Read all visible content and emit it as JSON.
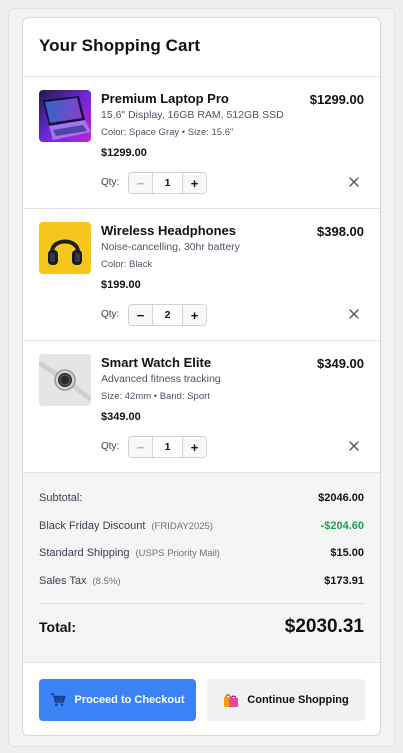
{
  "cart": {
    "title": "Your Shopping Cart",
    "qty_label": "Qty:",
    "items": [
      {
        "name": "Premium Laptop Pro",
        "description": "15.6\" Display, 16GB RAM, 512GB SSD",
        "options": "Color: Space Gray • Size: 15.6\"",
        "unit_price": "$1299.00",
        "line_total": "$1299.00",
        "quantity": "1",
        "image_icon": "laptop-image"
      },
      {
        "name": "Wireless Headphones",
        "description": "Noise-cancelling, 30hr battery",
        "options": "Color: Black",
        "unit_price": "$199.00",
        "line_total": "$398.00",
        "quantity": "2",
        "image_icon": "headphones-image"
      },
      {
        "name": "Smart Watch Elite",
        "description": "Advanced fitness tracking",
        "options": "Size: 42mm • Band: Sport",
        "unit_price": "$349.00",
        "line_total": "$349.00",
        "quantity": "1",
        "image_icon": "smartwatch-image"
      }
    ]
  },
  "summary": {
    "subtotal_label": "Subtotal:",
    "subtotal_value": "$2046.00",
    "discount_label": "Black Friday Discount",
    "discount_code": "(FRIDAY2025)",
    "discount_value": "-$204.60",
    "shipping_label": "Standard Shipping",
    "shipping_note": "(USPS Priority Mail)",
    "shipping_value": "$15.00",
    "tax_label": "Sales Tax",
    "tax_note": "(8.5%)",
    "tax_value": "$173.91",
    "total_label": "Total:",
    "total_value": "$2030.31"
  },
  "actions": {
    "checkout_label": "Proceed to Checkout",
    "continue_label": "Continue Shopping",
    "checkout_icon": "cart-icon",
    "continue_icon": "shopping-bags-icon"
  },
  "colors": {
    "primary": "#3b82f6",
    "discount": "#16a34a"
  }
}
